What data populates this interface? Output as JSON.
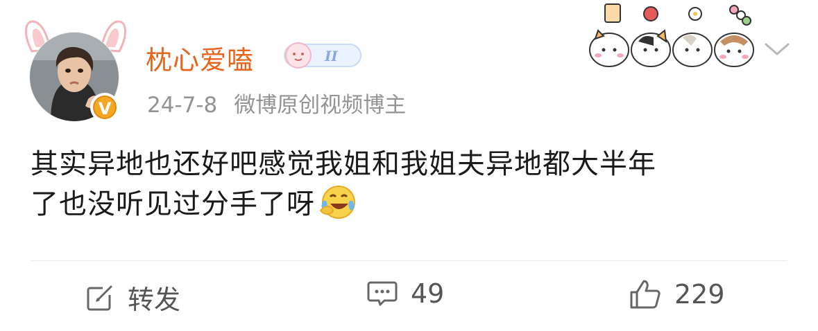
{
  "post": {
    "username": "枕心爱嗑",
    "date": "24-7-8",
    "tag": "微博原创视频博主",
    "content_line1": "其实异地也还好吧感觉我姐和我姐夫异地都大半年",
    "content_line2": "了也没听见过分手了呀",
    "level_badge": "II"
  },
  "actions": {
    "repost_label": "转发",
    "comment_count": "49",
    "like_count": "229"
  },
  "colors": {
    "username": "#e8631b",
    "meta": "#939393",
    "verified": "#f5a623",
    "text": "#1a1a1a"
  },
  "icons": [
    "rabbit-ears-icon",
    "verified-v-icon",
    "level-badge-icon",
    "sticker-deco-icon",
    "chevron-down-icon",
    "laughing-tears-emoji",
    "repost-icon",
    "comment-icon",
    "like-icon"
  ]
}
